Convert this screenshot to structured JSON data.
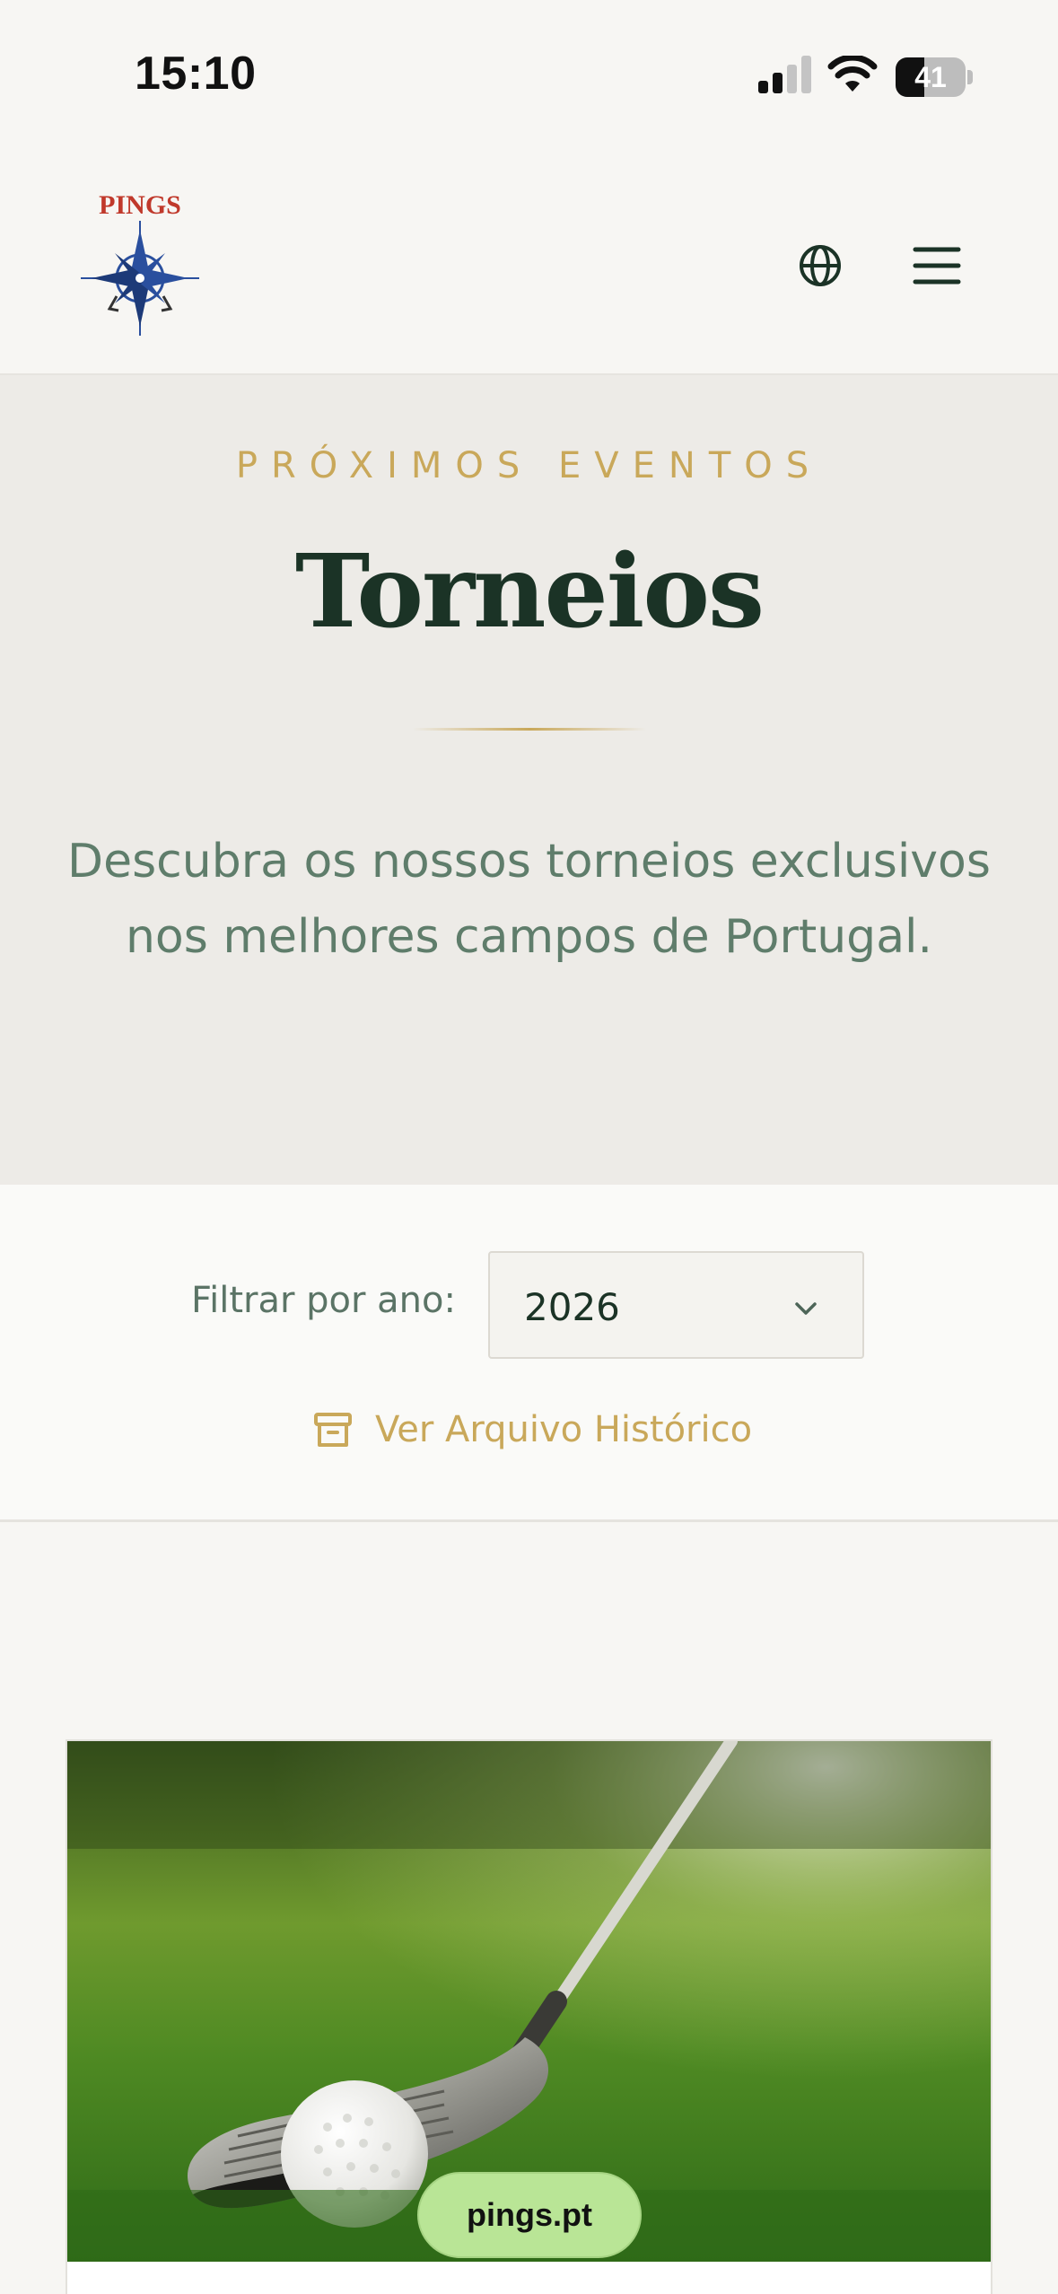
{
  "status_bar": {
    "time": "15:10",
    "battery": "41",
    "battery_level": 0.41,
    "icons": [
      "signal-icon",
      "wifi-icon",
      "battery-icon"
    ]
  },
  "header": {
    "logo_text": "PINGS",
    "icons": [
      "globe-icon",
      "menu-icon"
    ]
  },
  "hero": {
    "eyebrow": "PRÓXIMOS EVENTOS",
    "title": "Torneios",
    "subtitle_line1": "Descubra os nossos torneios exclusivos",
    "subtitle_line2": "nos melhores campos de Portugal."
  },
  "filter": {
    "label": "Filtrar por ano:",
    "selected_year": "2026",
    "archive_label": "Ver Arquivo Histórico",
    "archive_icon": "archive-icon"
  },
  "browser": {
    "url": "pings.pt"
  },
  "colors": {
    "accent_gold": "#c9a85a",
    "dark_green": "#1b3326",
    "muted_green": "#5f7d6b",
    "hero_bg": "#edebe7",
    "logo_red": "#c0392b",
    "logo_blue": "#2a4f9e"
  }
}
